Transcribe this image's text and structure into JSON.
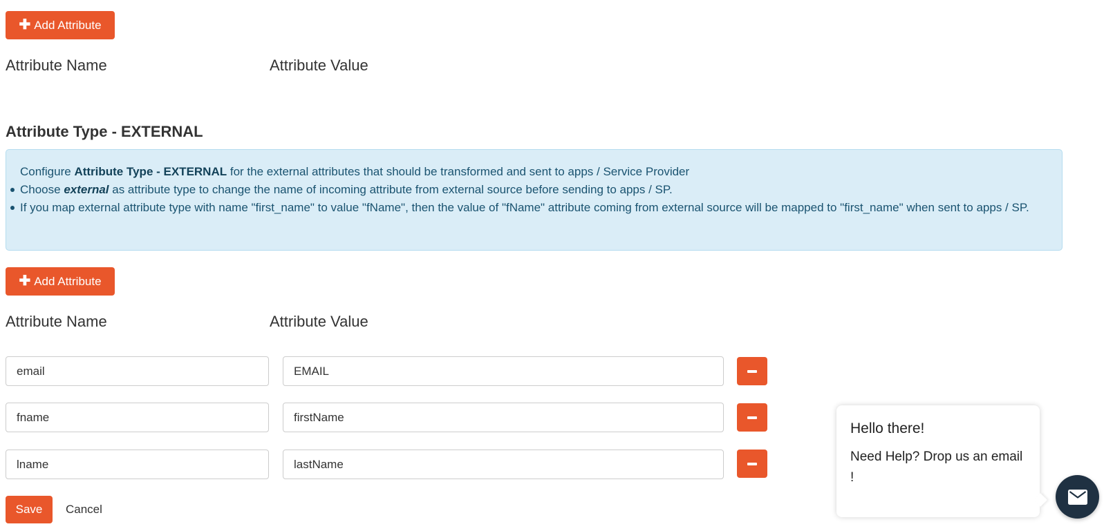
{
  "theme": {
    "accent": "#e9572b",
    "info_bg": "#daedf7",
    "info_text": "#1a5370",
    "chat_fab": "#1f3142"
  },
  "top_section": {
    "add_button_label": "Add Attribute",
    "col_name": "Attribute Name",
    "col_value": "Attribute Value"
  },
  "external_section": {
    "title": "Attribute Type - EXTERNAL",
    "info": {
      "line1_prefix": "Configure ",
      "line1_bold": "Attribute Type - EXTERNAL",
      "line1_suffix": " for the external attributes that should be transformed and sent to apps / Service Provider",
      "bullet1_prefix": "Choose ",
      "bullet1_em": "external",
      "bullet1_suffix": " as attribute type to change the name of incoming attribute from external source before sending to apps / SP.",
      "bullet2": "If you map external attribute type with name \"first_name\" to value \"fName\", then the value of \"fName\" attribute coming from external source will be mapped to \"first_name\" when sent to apps / SP."
    },
    "add_button_label": "Add Attribute",
    "col_name": "Attribute Name",
    "col_value": "Attribute Value",
    "rows": [
      {
        "name": "email",
        "value": "EMAIL"
      },
      {
        "name": "fname",
        "value": "firstName"
      },
      {
        "name": "lname",
        "value": "lastName"
      }
    ]
  },
  "actions": {
    "save_label": "Save",
    "cancel_label": "Cancel"
  },
  "chat": {
    "greeting": "Hello there!",
    "message": "Need Help? Drop us an email !",
    "fab_icon": "mail-icon"
  }
}
